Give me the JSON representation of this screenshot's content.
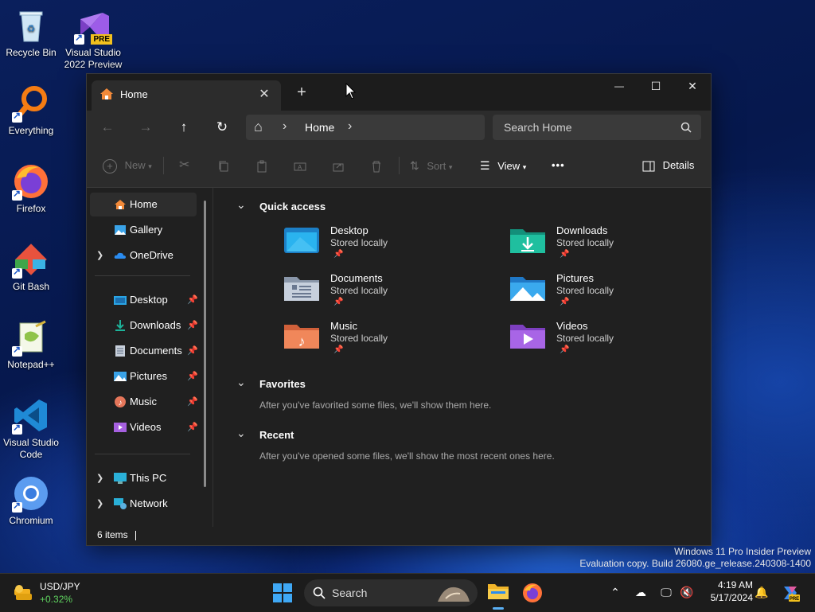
{
  "desktop": {
    "icons": [
      {
        "label1": "Recycle Bin",
        "label2": ""
      },
      {
        "label1": "Visual Studio",
        "label2": "2022 Preview",
        "badge": "PRE"
      },
      {
        "label1": "Everything",
        "label2": ""
      },
      {
        "label1": "Firefox",
        "label2": ""
      },
      {
        "label1": "Git Bash",
        "label2": ""
      },
      {
        "label1": "Notepad++",
        "label2": ""
      },
      {
        "label1": "Visual Studio",
        "label2": "Code"
      },
      {
        "label1": "Chromium",
        "label2": ""
      }
    ],
    "watermark": {
      "line1": "Windows 11 Pro Insider Preview",
      "line2": "Evaluation copy. Build 26080.ge_release.240308-1400"
    }
  },
  "window": {
    "tab": {
      "label": "Home",
      "close": "✕"
    },
    "new_tab": "+",
    "controls": {
      "minimize": "—",
      "maximize": "☐",
      "close": "✕"
    },
    "nav": {
      "back": "←",
      "forward": "→",
      "up": "↑",
      "refresh": "↻"
    },
    "address": {
      "home_icon": "⌂",
      "sep": "›",
      "location": "Home"
    },
    "search": {
      "placeholder": "Search Home"
    },
    "toolbar": {
      "new": "New",
      "sort": "Sort",
      "view": "View",
      "more": "•••",
      "details": "Details"
    },
    "sidebar": {
      "top": [
        {
          "label": "Home",
          "selected": true
        },
        {
          "label": "Gallery"
        },
        {
          "label": "OneDrive",
          "expandable": true
        }
      ],
      "pinned": [
        {
          "label": "Desktop"
        },
        {
          "label": "Downloads"
        },
        {
          "label": "Documents"
        },
        {
          "label": "Pictures"
        },
        {
          "label": "Music"
        },
        {
          "label": "Videos"
        }
      ],
      "bottom": [
        {
          "label": "This PC"
        },
        {
          "label": "Network"
        }
      ]
    },
    "content": {
      "quick_access": {
        "title": "Quick access",
        "items": [
          {
            "name": "Desktop",
            "status": "Stored locally",
            "color": "#2aa5e6"
          },
          {
            "name": "Downloads",
            "status": "Stored locally",
            "color": "#1db39a"
          },
          {
            "name": "Documents",
            "status": "Stored locally",
            "color": "#b8c4d4"
          },
          {
            "name": "Pictures",
            "status": "Stored locally",
            "color": "#3aa3e8"
          },
          {
            "name": "Music",
            "status": "Stored locally",
            "color": "#f0875a"
          },
          {
            "name": "Videos",
            "status": "Stored locally",
            "color": "#a660e0"
          }
        ]
      },
      "favorites": {
        "title": "Favorites",
        "empty": "After you've favorited some files, we'll show them here."
      },
      "recent": {
        "title": "Recent",
        "empty": "After you've opened some files, we'll show the most recent ones here."
      }
    },
    "status": {
      "items": "6 items"
    }
  },
  "taskbar": {
    "widget": {
      "ticker": "USD/JPY",
      "change": "+0.32%"
    },
    "search_label": "Search",
    "time": "4:19 AM",
    "date": "5/17/2024"
  }
}
